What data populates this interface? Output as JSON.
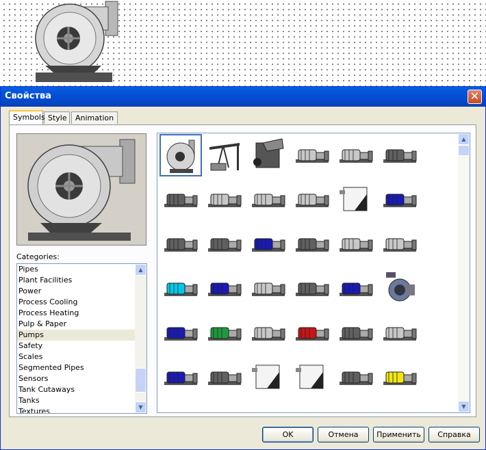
{
  "dialog": {
    "title": "Свойства",
    "close_glyph": "✕"
  },
  "tabs": [
    "Symbols",
    "Style",
    "Animation"
  ],
  "categories_label": "Categories:",
  "categories": [
    "Pipes",
    "Plant Facilities",
    "Power",
    "Process Cooling",
    "Process Heating",
    "Pulp & Paper",
    "Pumps",
    "Safety",
    "Scales",
    "Segmented Pipes",
    "Sensors",
    "Tank Cutaways",
    "Tanks",
    "Textures"
  ],
  "selected_category": "Pumps",
  "scroll_arrows": {
    "up": "▲",
    "down": "▼"
  },
  "symbol_colors": {
    "frame": "#606060",
    "light_gray": "#c8c8c8",
    "blue": "#1a1ab4",
    "cyan": "#00c8e6",
    "green": "#1e9a3c",
    "red": "#c81414",
    "yellow": "#f0e614",
    "selection": "#3c6fb4"
  },
  "buttons": {
    "ok": "OK",
    "cancel": "Отмена",
    "apply": "Применить",
    "help": "Справка"
  }
}
